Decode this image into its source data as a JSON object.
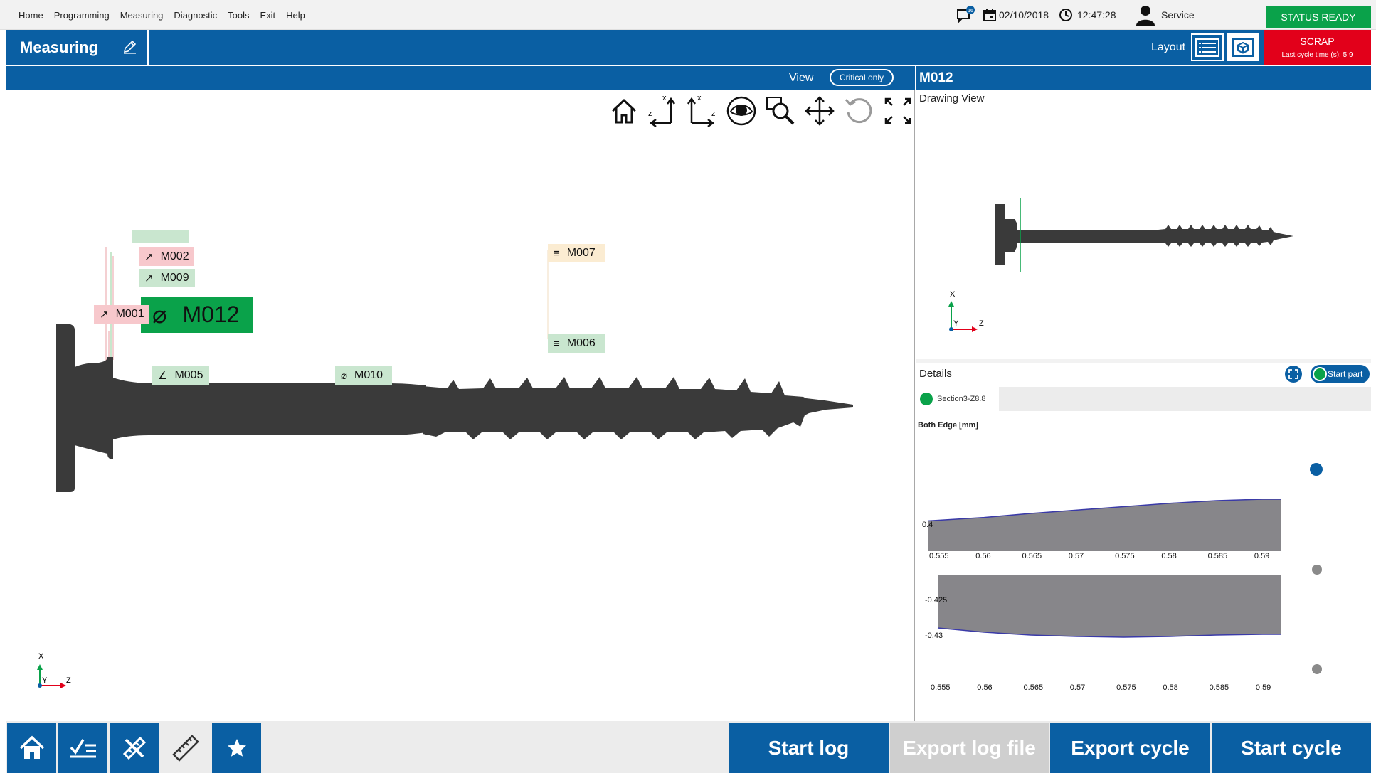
{
  "menu": {
    "items": [
      "Home",
      "Programming",
      "Measuring",
      "Diagnostic",
      "Tools",
      "Exit",
      "Help"
    ],
    "notification_count": "16",
    "date": "02/10/2018",
    "time": "12:47:28",
    "user": "Service",
    "status": "STATUS READY"
  },
  "titlebar": {
    "title": "Measuring",
    "layout_label": "Layout",
    "scrap_label": "SCRAP",
    "cycle_time_label": "Last cycle time (s): 5.9"
  },
  "viewbar": {
    "view_label": "View",
    "filter_label": "Critical only"
  },
  "viewport": {
    "tags": {
      "m012": "M012",
      "m002": "M002",
      "m009": "M009",
      "m001": "M001",
      "m007": "M007",
      "m006": "M006",
      "m005": "M005",
      "m010": "M010"
    },
    "axis": {
      "x": "X",
      "y": "Y",
      "z": "Z"
    }
  },
  "right_panel": {
    "header": "M012",
    "drawing_view_label": "Drawing View",
    "details_label": "Details",
    "start_part_label": "Start part",
    "section_tab": "Section3-Z8.8",
    "chart_title": "Both Edge [mm]"
  },
  "chart_data": {
    "type": "area",
    "title": "Both Edge [mm]",
    "xlabel": "",
    "ylabel": "",
    "x_ticks": [
      0.555,
      0.56,
      0.565,
      0.57,
      0.575,
      0.58,
      0.585,
      0.59
    ],
    "xlim": [
      0.555,
      0.592
    ],
    "panels": [
      {
        "y_ticks": [
          0.4
        ],
        "series_x": [
          0.554,
          0.56,
          0.565,
          0.57,
          0.575,
          0.58,
          0.585,
          0.59,
          0.592
        ],
        "series_y": [
          0.4005,
          0.401,
          0.4016,
          0.4021,
          0.4026,
          0.4031,
          0.4035,
          0.4037,
          0.4037
        ]
      },
      {
        "y_ticks": [
          -0.425,
          -0.43
        ],
        "series_x": [
          0.555,
          0.56,
          0.565,
          0.57,
          0.575,
          0.58,
          0.585,
          0.59,
          0.592
        ],
        "series_y": [
          -0.429,
          -0.4296,
          -0.43,
          -0.4302,
          -0.4303,
          -0.4302,
          -0.43,
          -0.4299,
          -0.4299
        ]
      }
    ]
  },
  "colors": {
    "brand_blue": "#0a5fa3",
    "status_green": "#0aa24a",
    "scrap_red": "#e2001a"
  },
  "bottombar": {
    "start_log": "Start log",
    "export_log_file": "Export log file",
    "export_cycle": "Export cycle",
    "start_cycle": "Start cycle"
  }
}
